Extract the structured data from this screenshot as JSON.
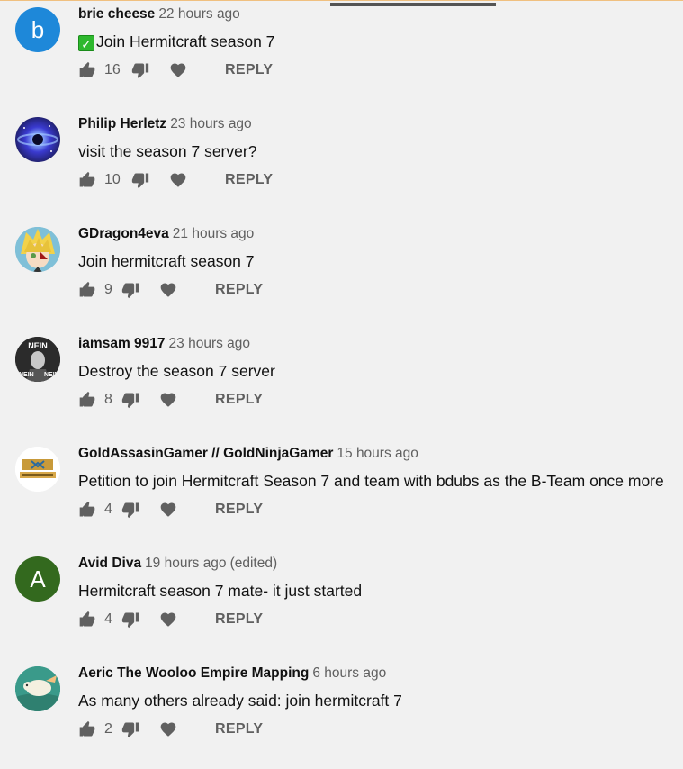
{
  "comments": [
    {
      "author": "brie cheese",
      "time": "22 hours ago",
      "edited": "",
      "text": "Join Hermitcraft season 7",
      "has_check_emoji": true,
      "likes": "16",
      "avatar_letter": "b",
      "avatar_color": "#1e88d9"
    },
    {
      "author": "Philip Herletz",
      "time": "23 hours ago",
      "edited": "",
      "text": "visit the season 7 server?",
      "likes": "10",
      "avatar_letter": "",
      "avatar_color": "#2a2a7a"
    },
    {
      "author": "GDragon4eva",
      "time": "21 hours ago",
      "edited": "",
      "text": "Join hermitcraft season 7",
      "likes": "9",
      "avatar_letter": "",
      "avatar_color": "#6fb0c8"
    },
    {
      "author": "iamsam 9917",
      "time": "23 hours ago",
      "edited": "",
      "text": "Destroy the season 7 server",
      "likes": "8",
      "avatar_letter": "",
      "avatar_color": "#2b2b2b",
      "avatar_text": "NEIN"
    },
    {
      "author": "GoldAssasinGamer // GoldNinjaGamer",
      "time": "15 hours ago",
      "edited": "",
      "text": "Petition to join Hermitcraft Season 7 and team with bdubs as the B-Team once more",
      "likes": "4",
      "avatar_letter": "",
      "avatar_color": "#ffffff"
    },
    {
      "author": "Avid Diva",
      "time": "19 hours ago",
      "edited": "(edited)",
      "text": "Hermitcraft season 7 mate- it just started",
      "likes": "4",
      "avatar_letter": "A",
      "avatar_color": "#33691e"
    },
    {
      "author": "Aeric The Wooloo Empire Mapping",
      "time": "6 hours ago",
      "edited": "",
      "text": "As many others already said: join hermitcraft 7",
      "likes": "2",
      "avatar_letter": "",
      "avatar_color": "#3a9a8a"
    }
  ],
  "labels": {
    "reply": "REPLY"
  },
  "colors": {
    "background": "#f1f1f1",
    "secondary_text": "#606060",
    "primary_text": "#111111"
  }
}
